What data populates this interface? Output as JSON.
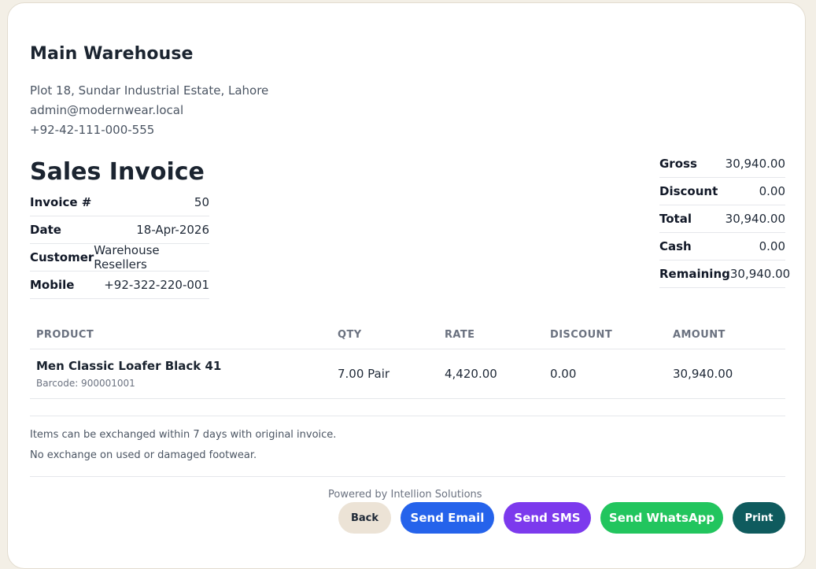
{
  "warehouse": {
    "name": "Main Warehouse",
    "address": "Plot 18, Sundar Industrial Estate, Lahore",
    "email": "admin@modernwear.local",
    "phone": "+92-42-111-000-555"
  },
  "invoice": {
    "title": "Sales Invoice",
    "meta": [
      {
        "label": "Invoice #",
        "value": "50"
      },
      {
        "label": "Date",
        "value": "18-Apr-2026"
      },
      {
        "label": "Customer",
        "value": "Warehouse Resellers"
      },
      {
        "label": "Mobile",
        "value": "+92-322-220-001"
      }
    ]
  },
  "totals": [
    {
      "label": "Gross",
      "value": "30,940.00"
    },
    {
      "label": "Discount",
      "value": "0.00"
    },
    {
      "label": "Total",
      "value": "30,940.00"
    },
    {
      "label": "Cash",
      "value": "0.00"
    },
    {
      "label": "Remaining",
      "value": "30,940.00"
    }
  ],
  "items_table": {
    "headers": [
      "PRODUCT",
      "QTY",
      "RATE",
      "DISCOUNT",
      "AMOUNT"
    ],
    "rows": [
      {
        "product": "Men Classic Loafer Black 41",
        "barcode": "Barcode: 900001001",
        "qty": "7.00 Pair",
        "rate": "4,420.00",
        "discount": "0.00",
        "amount": "30,940.00"
      }
    ]
  },
  "notes": [
    "Items can be exchanged within 7 days with original invoice.",
    "No exchange on used or damaged footwear."
  ],
  "footer": {
    "powered_by": "Powered by Intellion Solutions"
  },
  "actions": {
    "back": "Back",
    "send_email": "Send Email",
    "send_sms": "Send SMS",
    "send_whatsapp": "Send WhatsApp",
    "print": "Print"
  },
  "colors": {
    "page_bg": "#f3efe6",
    "email_btn": "#2563eb",
    "sms_btn": "#7c3aed",
    "whatsapp_btn": "#22c55e",
    "print_btn": "#0f5b5e",
    "back_btn": "#ece3d6"
  }
}
